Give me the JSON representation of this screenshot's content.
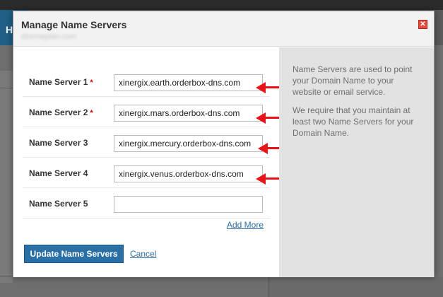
{
  "background": {
    "header_letter": "H"
  },
  "modal": {
    "title": "Manage Name Servers",
    "subtitle": "stormeplan.com",
    "close_label": "✕"
  },
  "name_servers": [
    {
      "label": "Name Server 1",
      "required": "*",
      "value": "xinergix.earth.orderbox-dns.com"
    },
    {
      "label": "Name Server 2",
      "required": "*",
      "value": "xinergix.mars.orderbox-dns.com"
    },
    {
      "label": "Name Server 3",
      "required": "",
      "value": "xinergix.mercury.orderbox-dns.com"
    },
    {
      "label": "Name Server 4",
      "required": "",
      "value": "xinergix.venus.orderbox-dns.com"
    },
    {
      "label": "Name Server 5",
      "required": "",
      "value": ""
    }
  ],
  "actions": {
    "add_more": "Add More",
    "update": "Update Name Servers",
    "cancel": "Cancel"
  },
  "info": {
    "para1": "Name Servers are used to point your Domain Name to your website or email service.",
    "para2": "We require that you maintain at least two Name Servers for your Domain Name."
  },
  "colors": {
    "primary_button": "#2a6fa6",
    "link": "#2f6ea2",
    "arrow": "#e8141a",
    "required_mark": "#cc0000"
  }
}
